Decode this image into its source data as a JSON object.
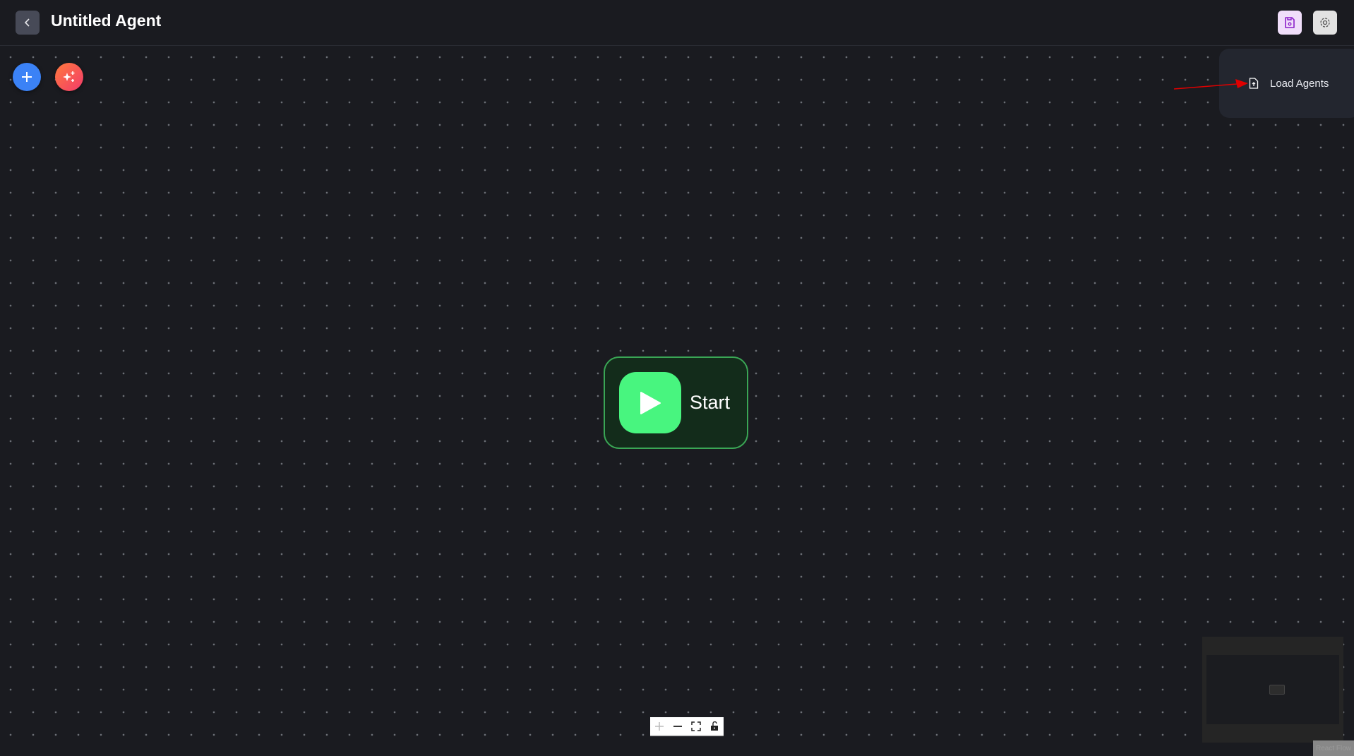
{
  "header": {
    "title": "Untitled Agent",
    "back_icon": "chevron-left-icon",
    "save_icon": "save-icon",
    "settings_icon": "gear-icon"
  },
  "toolbar": {
    "add_icon": "plus-icon",
    "ai_icon": "sparkles-icon"
  },
  "menu": {
    "load_agents_label": "Load Agents",
    "icon": "file-upload-icon"
  },
  "node": {
    "label": "Start",
    "icon": "play-icon"
  },
  "colors": {
    "accent_blue": "#3b82f6",
    "start_green": "#48f57f",
    "node_border": "#3aa655",
    "annotation_red": "#e00000"
  },
  "attribution": "React Flow"
}
